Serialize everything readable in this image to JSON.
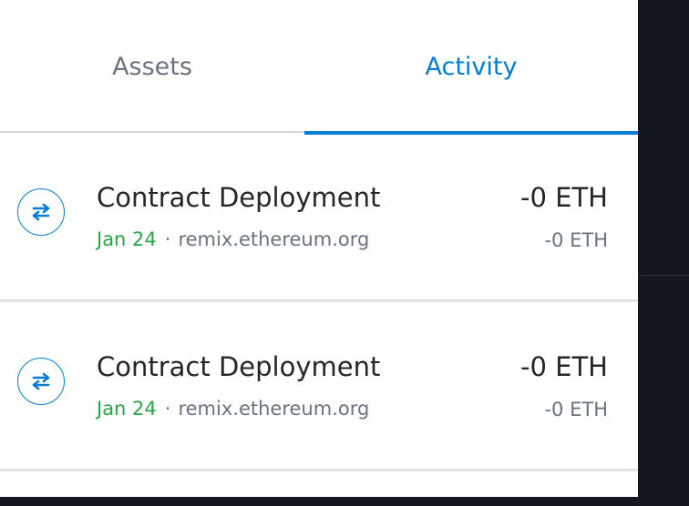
{
  "tabs": {
    "assets_label": "Assets",
    "activity_label": "Activity",
    "active": "Activity"
  },
  "activity": {
    "items": [
      {
        "icon": "swap-arrows-icon",
        "title": "Contract Deployment",
        "date": "Jan 24",
        "separator": "·",
        "origin": "remix.ethereum.org",
        "primary_amount": "-0 ETH",
        "secondary_amount": "-0 ETH"
      },
      {
        "icon": "swap-arrows-icon",
        "title": "Contract Deployment",
        "date": "Jan 24",
        "separator": "·",
        "origin": "remix.ethereum.org",
        "primary_amount": "-0 ETH",
        "secondary_amount": "-0 ETH"
      }
    ]
  },
  "colors": {
    "accent": "#037dd6",
    "date_green": "#28a745",
    "text_primary": "#24272a",
    "text_muted": "#6a737d",
    "backdrop": "#14171d"
  }
}
